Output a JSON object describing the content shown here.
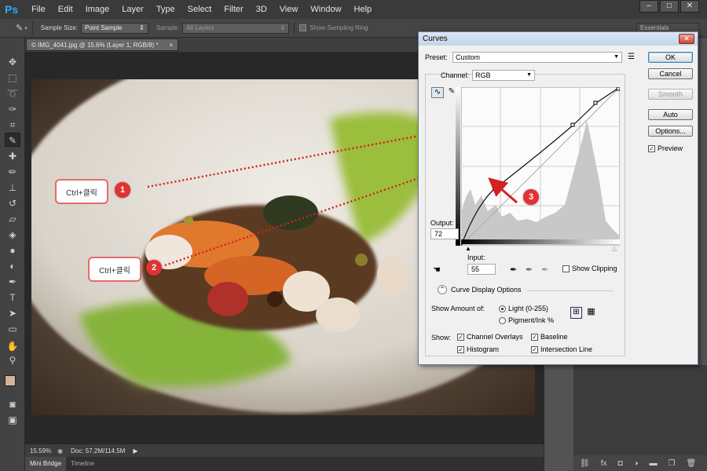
{
  "app": {
    "logo": "Ps",
    "menu": [
      "File",
      "Edit",
      "Image",
      "Layer",
      "Type",
      "Select",
      "Filter",
      "3D",
      "View",
      "Window",
      "Help"
    ],
    "window_controls": [
      "–",
      "□",
      "✕"
    ]
  },
  "options_bar": {
    "sample_size_label": "Sample Size:",
    "sample_size_value": "Point Sample",
    "sample_label": "Sample:",
    "sample_value": "All Layers",
    "show_sampling_ring": "Show Sampling Ring",
    "workspace": "Essentials"
  },
  "document": {
    "tab_title": "© IMG_4041.jpg @ 15.6% (Layer 1, RGB/8) *",
    "zoom": "15.59%",
    "doc_size": "Doc: 57.2M/114.5M",
    "bottom_tabs": [
      "Mini Bridge",
      "Timeline"
    ]
  },
  "annotations": {
    "callout1": "Ctrl+클릭",
    "badge1": "1",
    "callout2": "Ctrl+클릭",
    "badge2": "2",
    "badge3": "3"
  },
  "curves": {
    "title": "Curves",
    "preset_label": "Preset:",
    "preset_value": "Custom",
    "channel_label": "Channel:",
    "channel_value": "RGB",
    "output_label": "Output:",
    "output_value": "72",
    "input_label": "Input:",
    "input_value": "55",
    "show_clipping": "Show Clipping",
    "curve_display_options": "Curve Display Options",
    "show_amount_label": "Show Amount of:",
    "light_option": "Light  (0-255)",
    "pigment_option": "Pigment/Ink %",
    "show_label": "Show:",
    "channel_overlays": "Channel Overlays",
    "baseline": "Baseline",
    "histogram": "Histogram",
    "intersection_line": "Intersection Line",
    "buttons": {
      "ok": "OK",
      "cancel": "Cancel",
      "smooth": "Smooth",
      "auto": "Auto",
      "options": "Options..."
    },
    "preview_label": "Preview",
    "preview_checked": true,
    "light_selected": true,
    "accent_red": "#d42020"
  }
}
